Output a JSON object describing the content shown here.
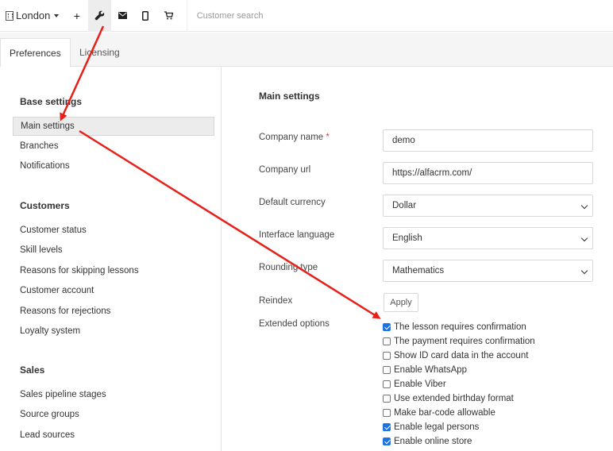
{
  "navbar": {
    "branch": "London",
    "search_placeholder": "Customer search",
    "buttons": [
      {
        "name": "add-button",
        "glyph": "+"
      },
      {
        "name": "wrench-button",
        "glyph": "🔧"
      },
      {
        "name": "mail-button",
        "glyph": "✉"
      },
      {
        "name": "phone-button",
        "glyph": "▯"
      },
      {
        "name": "cart-button",
        "glyph": "🛒"
      }
    ]
  },
  "tabs": {
    "preferences": "Preferences",
    "licensing": "Licensing"
  },
  "sidebar": {
    "base_settings": {
      "heading": "Base settings",
      "items": [
        "Main settings",
        "Branches",
        "Notifications"
      ]
    },
    "customers": {
      "heading": "Customers",
      "items": [
        "Customer status",
        "Skill levels",
        "Reasons for skipping lessons",
        "Customer account",
        "Reasons for rejections",
        "Loyalty system"
      ]
    },
    "sales": {
      "heading": "Sales",
      "items": [
        "Sales pipeline stages",
        "Source groups",
        "Lead sources"
      ]
    }
  },
  "main": {
    "title": "Main settings",
    "company_name": {
      "label": "Company name",
      "required_mark": "*",
      "value": "demo"
    },
    "company_url": {
      "label": "Company url",
      "value": "https://alfacrm.com/"
    },
    "default_currency": {
      "label": "Default currency",
      "value": "Dollar"
    },
    "interface_language": {
      "label": "Interface language",
      "value": "English"
    },
    "rounding_type": {
      "label": "Rounding type",
      "value": "Mathematics"
    },
    "reindex": {
      "label": "Reindex",
      "button": "Apply"
    },
    "extended_options": {
      "label": "Extended options",
      "options": [
        {
          "label": "The lesson requires confirmation",
          "checked": true
        },
        {
          "label": "The payment requires confirmation",
          "checked": false
        },
        {
          "label": "Show ID card data in the account",
          "checked": false
        },
        {
          "label": "Enable WhatsApp",
          "checked": false
        },
        {
          "label": "Enable Viber",
          "checked": false
        },
        {
          "label": "Use extended birthday format",
          "checked": false
        },
        {
          "label": "Make bar-code allowable",
          "checked": false
        },
        {
          "label": "Enable legal persons",
          "checked": true
        },
        {
          "label": "Enable online store",
          "checked": true
        }
      ]
    }
  },
  "colors": {
    "annotation_arrow": "#e8201a",
    "checkbox_checked": "#1a73e8",
    "required_mark": "#e0403c"
  }
}
